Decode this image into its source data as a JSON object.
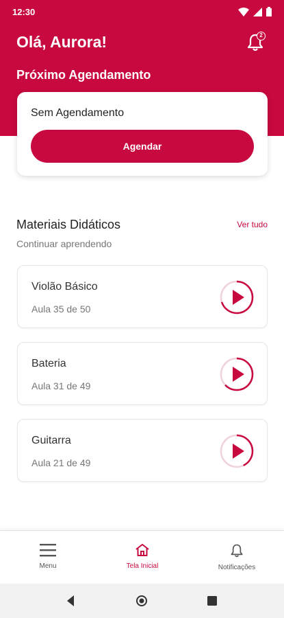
{
  "status_bar": {
    "time": "12:30"
  },
  "header": {
    "greeting": "Olá, Aurora!",
    "notification_count": "2",
    "next_appointment_title": "Próximo Agendamento"
  },
  "appointment": {
    "empty_text": "Sem Agendamento",
    "button_label": "Agendar"
  },
  "materials": {
    "title": "Materiais Didáticos",
    "subtitle": "Continuar aprendendo",
    "see_all": "Ver tudo",
    "courses": [
      {
        "name": "Violão Básico",
        "lesson": "Aula 35 de 50",
        "progress": 0.7
      },
      {
        "name": "Bateria",
        "lesson": "Aula 31 de 49",
        "progress": 0.63
      },
      {
        "name": "Guitarra",
        "lesson": "Aula 21 de 49",
        "progress": 0.43
      }
    ]
  },
  "bottom_nav": {
    "items": [
      {
        "label": "Menu",
        "icon": "hamburger-icon"
      },
      {
        "label": "Tela Inicial",
        "icon": "home-icon",
        "active": true
      },
      {
        "label": "Notificações",
        "icon": "bell-icon"
      }
    ]
  },
  "colors": {
    "brand": "#c8093f"
  }
}
